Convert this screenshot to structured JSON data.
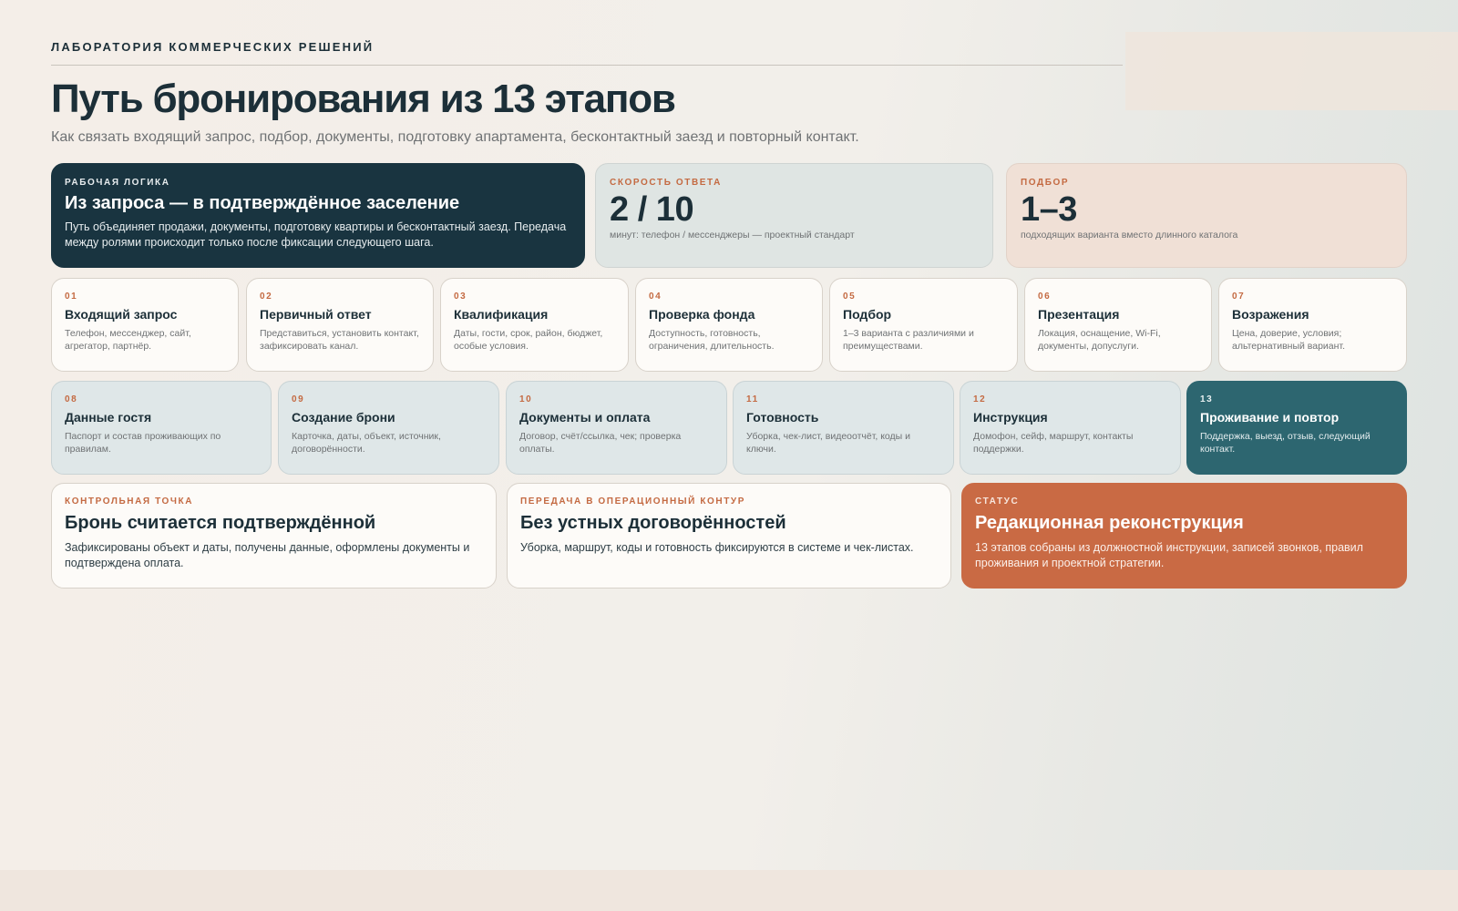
{
  "header": {
    "eyebrow": "ЛАБОРАТОРИЯ КОММЕРЧЕСКИХ РЕШЕНИЙ",
    "title": "Путь бронирования из 13 этапов",
    "subtitle": "Как связать входящий запрос, подбор, документы, подготовку апартамента, бесконтактный заезд и повторный контакт."
  },
  "hero": {
    "label": "РАБОЧАЯ ЛОГИКА",
    "heading": "Из запроса — в подтверждённое заселение",
    "text": "Путь объединяет продажи, документы, подготовку квартиры и бесконтактный заезд. Передача между ролями происходит только после фиксации следующего шага."
  },
  "stats": [
    {
      "label": "СКОРОСТЬ ОТВЕТА",
      "value": "2 / 10",
      "caption": "минут: телефон / мессенджеры — проектный стандарт"
    },
    {
      "label": "ПОДБОР",
      "value": "1–3",
      "caption": "подходящих варианта вместо длинного каталога"
    }
  ],
  "steps": [
    {
      "num": "01",
      "title": "Входящий запрос",
      "text": "Телефон, мессенджер, сайт, агрегатор, партнёр."
    },
    {
      "num": "02",
      "title": "Первичный ответ",
      "text": "Представиться, установить контакт, зафиксировать канал."
    },
    {
      "num": "03",
      "title": "Квалификация",
      "text": "Даты, гости, срок, район, бюджет, особые условия."
    },
    {
      "num": "04",
      "title": "Проверка фонда",
      "text": "Доступность, готовность, ограничения, длительность."
    },
    {
      "num": "05",
      "title": "Подбор",
      "text": "1–3 варианта с различиями и преимуществами."
    },
    {
      "num": "06",
      "title": "Презентация",
      "text": "Локация, оснащение, Wi-Fi, документы, допуслуги."
    },
    {
      "num": "07",
      "title": "Возражения",
      "text": "Цена, доверие, условия; альтернативный вариант."
    },
    {
      "num": "08",
      "title": "Данные гостя",
      "text": "Паспорт и состав проживающих по правилам."
    },
    {
      "num": "09",
      "title": "Создание брони",
      "text": "Карточка, даты, объект, источник, договорённости."
    },
    {
      "num": "10",
      "title": "Документы и оплата",
      "text": "Договор, счёт/ссылка, чек; проверка оплаты."
    },
    {
      "num": "11",
      "title": "Готовность",
      "text": "Уборка, чек-лист, видеоотчёт, коды и ключи."
    },
    {
      "num": "12",
      "title": "Инструкция",
      "text": "Домофон, сейф, маршрут, контакты поддержки."
    },
    {
      "num": "13",
      "title": "Проживание и повтор",
      "text": "Поддержка, выезд, отзыв, следующий контакт."
    }
  ],
  "bottom": [
    {
      "label": "КОНТРОЛЬНАЯ ТОЧКА",
      "heading": "Бронь считается подтверждённой",
      "text": "Зафиксированы объект и даты, получены данные, оформлены документы и подтверждена оплата."
    },
    {
      "label": "ПЕРЕДАЧА В ОПЕРАЦИОННЫЙ КОНТУР",
      "heading": "Без устных договорённостей",
      "text": "Уборка, маршрут, коды и готовность фиксируются в системе и чек-листах."
    },
    {
      "label": "СТАТУС",
      "heading": "Редакционная реконструкция",
      "text": "13 этапов собраны из должностной инструкции, записей звонков, правил проживания и проектной стратегии."
    }
  ],
  "colors": {
    "navy": "#193440",
    "teal": "#2d6670",
    "accent": "#c96a44",
    "label": "#c46a42"
  }
}
